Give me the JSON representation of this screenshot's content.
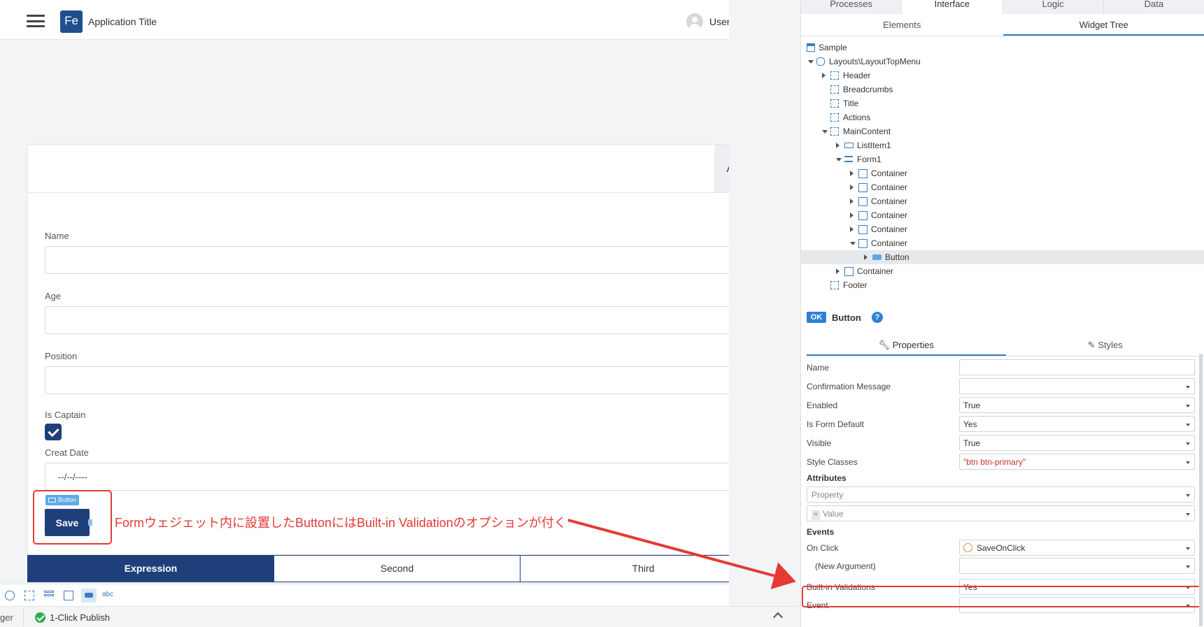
{
  "app": {
    "logo_text": "Fe",
    "title": "Application Title",
    "username": "Username",
    "logout_icon": "sign-out-icon"
  },
  "action_bar": {
    "label": "Action"
  },
  "form": {
    "fields": [
      {
        "label": "Name",
        "value": ""
      },
      {
        "label": "Age",
        "value": ""
      },
      {
        "label": "Position",
        "value": ""
      }
    ],
    "captain_label": "Is Captain",
    "captain_checked": true,
    "date_label": "Creat Date",
    "date_value": "--/--/----",
    "button_tag": "Button",
    "save_label": "Save"
  },
  "annotation": "Formウェジェット内に設置したButtonにはBuilt-in Validationのオプションが付く",
  "tabs": [
    "Expression",
    "Second",
    "Third"
  ],
  "active_tab": "Expression",
  "widget_toolbar": {
    "text_tool": "abc"
  },
  "status_bar": {
    "left_text": "ger",
    "publish_label": "1-Click Publish"
  },
  "right_panel": {
    "top_tabs": [
      "Processes",
      "Interface",
      "Logic",
      "Data"
    ],
    "active_top_tab": "Interface",
    "sub_tabs": [
      "Elements",
      "Widget Tree"
    ],
    "active_sub_tab": "Widget Tree",
    "tree": [
      {
        "label": "Sample",
        "icon": "screen-icon"
      },
      {
        "label": "Layouts\\LayoutTopMenu",
        "icon": "layout-icon"
      },
      {
        "label": "Header",
        "icon": "placeholder-icon"
      },
      {
        "label": "Breadcrumbs",
        "icon": "placeholder-icon"
      },
      {
        "label": "Title",
        "icon": "placeholder-icon"
      },
      {
        "label": "Actions",
        "icon": "placeholder-icon"
      },
      {
        "label": "MainContent",
        "icon": "placeholder-icon"
      },
      {
        "label": "ListItem1",
        "icon": "list-item-icon"
      },
      {
        "label": "Form1",
        "icon": "form-icon"
      },
      {
        "label": "Container",
        "icon": "container-icon"
      },
      {
        "label": "Container",
        "icon": "container-icon"
      },
      {
        "label": "Container",
        "icon": "container-icon"
      },
      {
        "label": "Container",
        "icon": "container-icon"
      },
      {
        "label": "Container",
        "icon": "container-icon"
      },
      {
        "label": "Container",
        "icon": "container-icon"
      },
      {
        "label": "Button",
        "icon": "button-icon"
      },
      {
        "label": "Container",
        "icon": "container-icon"
      },
      {
        "label": "Footer",
        "icon": "placeholder-icon"
      }
    ],
    "props_badge": "OK",
    "props_title": "Button",
    "prop_tabs": [
      "Properties",
      "Styles"
    ],
    "active_prop_tab": "Properties",
    "properties": [
      {
        "label": "Name",
        "value": ""
      },
      {
        "label": "Confirmation Message",
        "value": ""
      },
      {
        "label": "Enabled",
        "value": "True"
      },
      {
        "label": "Is Form Default",
        "value": "Yes"
      },
      {
        "label": "Visible",
        "value": "True"
      },
      {
        "label": "Style Classes",
        "value": "\"btn btn-primary\""
      }
    ],
    "attributes_title": "Attributes",
    "attr_property_placeholder": "Property",
    "attr_value_placeholder": "Value",
    "events_title": "Events",
    "events": [
      {
        "label": "On Click",
        "value": "SaveOnClick"
      },
      {
        "label": "(New Argument)",
        "value": ""
      },
      {
        "label": "Built-in Validations",
        "value": "Yes"
      },
      {
        "label": "Event",
        "value": ""
      }
    ]
  },
  "colors": {
    "primary": "#1f3f7a",
    "accent": "#3b7cc4",
    "annotation_red": "#e53935",
    "publish_green": "#35a852"
  }
}
